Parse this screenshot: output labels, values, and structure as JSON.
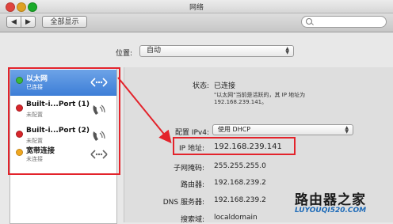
{
  "window": {
    "title": "网络"
  },
  "toolbar": {
    "back": "◀",
    "forward": "▶",
    "show_all": "全部显示"
  },
  "location": {
    "label": "位置:",
    "value": "自动"
  },
  "services": [
    {
      "name": "以太网",
      "status": "已连接",
      "dot_color": "#3cb83c",
      "icon": "ethernet-icon",
      "selected": true
    },
    {
      "name": "Built-i...Port (1)",
      "status": "未配置",
      "dot_color": "#d8262b",
      "icon": "phone-modem-icon",
      "selected": false
    },
    {
      "name": "Built-i...Port (2)",
      "status": "未配置",
      "dot_color": "#d8262b",
      "icon": "phone-modem-icon",
      "selected": false
    },
    {
      "name": "宽带连接",
      "status": "未连接",
      "dot_color": "#f0a820",
      "icon": "ethernet-icon",
      "selected": false
    }
  ],
  "detail": {
    "status_label": "状态:",
    "status_value": "已连接",
    "status_note": "\"以太网\"当前是活跃的，其 IP 地址为 192.168.239.141。",
    "configure_label": "配置 IPv4:",
    "configure_value": "使用 DHCP",
    "ip_label": "IP 地址:",
    "ip_value": "192.168.239.141",
    "subnet_label": "子网掩码:",
    "subnet_value": "255.255.255.0",
    "router_label": "路由器:",
    "router_value": "192.168.239.2",
    "dns_label": "DNS 服务器:",
    "dns_value": "192.168.239.2",
    "search_label": "搜索域:",
    "search_value": "localdomain"
  },
  "watermark": {
    "text": "路由器之家",
    "url": "LUYOUQI520.COM"
  },
  "colors": {
    "annotation": "#e3232b",
    "selection": "#3d7ed7"
  }
}
